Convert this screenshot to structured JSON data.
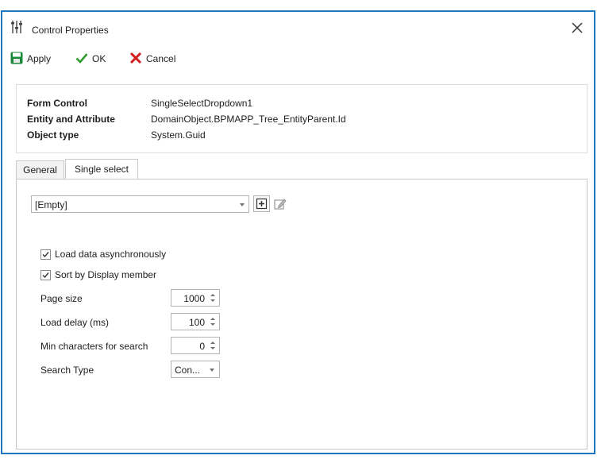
{
  "window": {
    "title": "Control Properties"
  },
  "toolbar": {
    "apply_label": "Apply",
    "ok_label": "OK",
    "cancel_label": "Cancel"
  },
  "info": {
    "rows": [
      {
        "key": "Form Control",
        "value": "SingleSelectDropdown1"
      },
      {
        "key": "Entity and Attribute",
        "value": "DomainObject.BPMAPP_Tree_EntityParent.Id"
      },
      {
        "key": "Object type",
        "value": "System.Guid"
      }
    ]
  },
  "tabs": [
    {
      "label": "General",
      "active": false
    },
    {
      "label": "Single select",
      "active": true
    }
  ],
  "single_select": {
    "datasource_value": "[Empty]",
    "checkboxes": [
      {
        "label": "Load data asynchronously",
        "checked": true
      },
      {
        "label": "Sort by Display member",
        "checked": true
      }
    ],
    "properties": [
      {
        "label": "Page size",
        "value": "1000"
      },
      {
        "label": "Load delay (ms)",
        "value": "100"
      },
      {
        "label": "Min characters for search",
        "value": "0"
      },
      {
        "label": "Search Type",
        "value": "Con..."
      }
    ]
  },
  "colors": {
    "accent_border": "#1d76bf",
    "ok_green": "#2f9a2f",
    "cancel_red": "#d01c1c",
    "save_green": "#1a8a3a"
  },
  "icons": {
    "title": "sliders-icon",
    "close": "close-icon",
    "apply": "save-icon",
    "ok": "checkmark-icon",
    "cancel": "x-icon",
    "add": "add-icon",
    "edit": "edit-icon"
  }
}
